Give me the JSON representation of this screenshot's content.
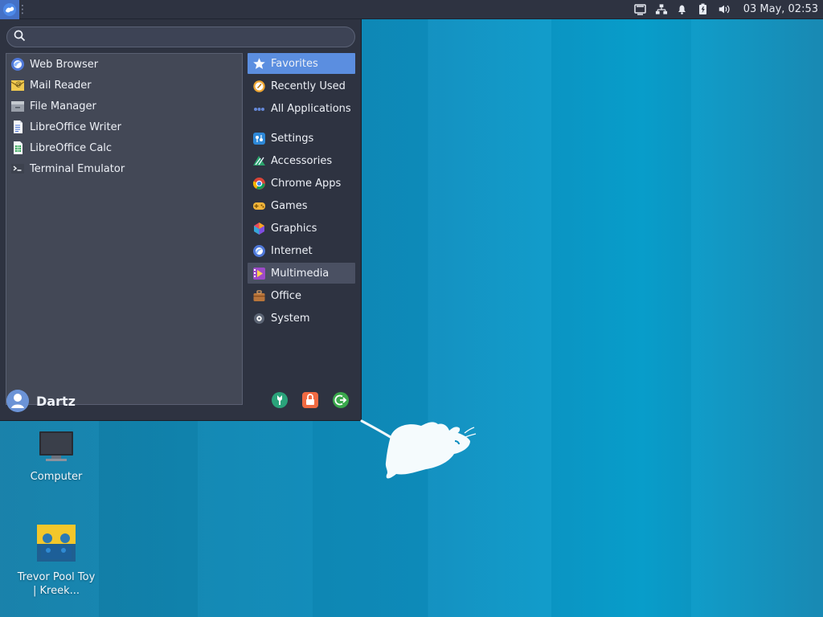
{
  "panel": {
    "clock": "03 May, 02:53",
    "tray_icons": [
      "display-icon",
      "network-icon",
      "notification-icon",
      "battery-icon",
      "volume-icon"
    ]
  },
  "menu": {
    "search": {
      "value": "",
      "placeholder": ""
    },
    "favorites": [
      {
        "label": "Web Browser",
        "icon": "web-browser-icon"
      },
      {
        "label": "Mail Reader",
        "icon": "mail-reader-icon"
      },
      {
        "label": "File Manager",
        "icon": "file-manager-icon"
      },
      {
        "label": "LibreOffice Writer",
        "icon": "libreoffice-writer-icon"
      },
      {
        "label": "LibreOffice Calc",
        "icon": "libreoffice-calc-icon"
      },
      {
        "label": "Terminal Emulator",
        "icon": "terminal-icon"
      }
    ],
    "categories": [
      {
        "label": "Favorites",
        "icon": "star-icon",
        "selected": true
      },
      {
        "label": "Recently Used",
        "icon": "clock-icon"
      },
      {
        "label": "All Applications",
        "icon": "all-apps-icon"
      },
      {
        "label": "Settings",
        "icon": "settings-icon"
      },
      {
        "label": "Accessories",
        "icon": "accessories-icon"
      },
      {
        "label": "Chrome Apps",
        "icon": "chrome-icon"
      },
      {
        "label": "Games",
        "icon": "games-icon"
      },
      {
        "label": "Graphics",
        "icon": "graphics-icon"
      },
      {
        "label": "Internet",
        "icon": "internet-icon"
      },
      {
        "label": "Multimedia",
        "icon": "multimedia-icon",
        "hovered": true
      },
      {
        "label": "Office",
        "icon": "office-icon"
      },
      {
        "label": "System",
        "icon": "system-icon"
      }
    ],
    "user": {
      "name": "Dartz"
    },
    "actions": [
      "settings-manager-icon",
      "lock-icon",
      "logout-icon"
    ]
  },
  "desktop": {
    "icons": [
      {
        "label": "Computer",
        "icon": "computer-icon"
      },
      {
        "label": "Trevor Pool Toy | Kreek...",
        "icon": "image-thumbnail-icon"
      }
    ]
  },
  "colors": {
    "panel": "#2e3341",
    "menu_selected": "#5b8ee0",
    "menu_hover": "#4a5062",
    "desktop_blue": "#0d8ebf"
  }
}
